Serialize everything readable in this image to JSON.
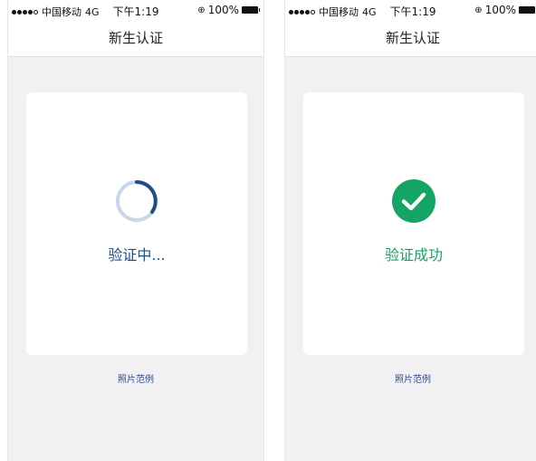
{
  "screens": [
    {
      "status_bar": {
        "carrier": "中国移动",
        "network": "4G",
        "time": "下午1:19",
        "battery": "100%"
      },
      "nav_title": "新生认证",
      "state_label": "验证中...",
      "footer_link": "照片范例",
      "colors": {
        "label": "#1f4e8c",
        "spinner": "#1f4e8c"
      }
    },
    {
      "status_bar": {
        "carrier": "中国移动",
        "network": "4G",
        "time": "下午1:19",
        "battery": "100%"
      },
      "nav_title": "新生认证",
      "state_label": "验证成功",
      "footer_link": "照片范例",
      "colors": {
        "label": "#14a463",
        "icon": "#14a463"
      }
    }
  ]
}
